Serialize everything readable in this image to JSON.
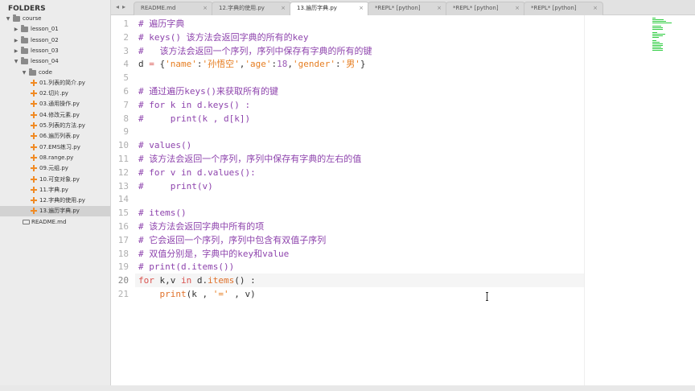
{
  "sidebar": {
    "header": "FOLDERS",
    "items": [
      {
        "label": "course",
        "type": "folder",
        "expanded": true,
        "depth": 0
      },
      {
        "label": "lesson_01",
        "type": "folder",
        "expanded": false,
        "depth": 1
      },
      {
        "label": "lesson_02",
        "type": "folder",
        "expanded": false,
        "depth": 1
      },
      {
        "label": "lesson_03",
        "type": "folder",
        "expanded": false,
        "depth": 1
      },
      {
        "label": "lesson_04",
        "type": "folder",
        "expanded": true,
        "depth": 1
      },
      {
        "label": "code",
        "type": "folder",
        "expanded": true,
        "depth": 2
      },
      {
        "label": "01.列表的简介.py",
        "type": "py",
        "depth": 3
      },
      {
        "label": "02.切片.py",
        "type": "py",
        "depth": 3
      },
      {
        "label": "03.通用操作.py",
        "type": "py",
        "depth": 3
      },
      {
        "label": "04.修改元素.py",
        "type": "py",
        "depth": 3
      },
      {
        "label": "05.列表的方法.py",
        "type": "py",
        "depth": 3
      },
      {
        "label": "06.遍历列表.py",
        "type": "py",
        "depth": 3
      },
      {
        "label": "07.EMS练习.py",
        "type": "py",
        "depth": 3
      },
      {
        "label": "08.range.py",
        "type": "py",
        "depth": 3
      },
      {
        "label": "09.元组.py",
        "type": "py",
        "depth": 3
      },
      {
        "label": "10.可变对象.py",
        "type": "py",
        "depth": 3
      },
      {
        "label": "11.字典.py",
        "type": "py",
        "depth": 3
      },
      {
        "label": "12.字典的使用.py",
        "type": "py",
        "depth": 3
      },
      {
        "label": "13.遍历字典.py",
        "type": "py",
        "depth": 3,
        "selected": true
      },
      {
        "label": "README.md",
        "type": "md",
        "depth": 2
      }
    ]
  },
  "tabs": {
    "back_arrow": "◂",
    "forward_arrow": "▸",
    "items": [
      {
        "label": "README.md",
        "active": false
      },
      {
        "label": "12.字典的使用.py",
        "active": false
      },
      {
        "label": "13.遍历字典.py",
        "active": true
      },
      {
        "label": "*REPL* [python]",
        "active": false
      },
      {
        "label": "*REPL* [python]",
        "active": false
      },
      {
        "label": "*REPL* [python]",
        "active": false
      }
    ],
    "close_glyph": "×"
  },
  "editor": {
    "current_line": 20,
    "lines": [
      [
        {
          "t": "c",
          "v": "# 遍历字典"
        }
      ],
      [
        {
          "t": "c",
          "v": "# keys() 该方法会返回字典的所有的key"
        }
      ],
      [
        {
          "t": "c",
          "v": "#   该方法会返回一个序列，序列中保存有字典的所有的键"
        }
      ],
      [
        {
          "t": "plain",
          "v": "d "
        },
        {
          "t": "op",
          "v": "="
        },
        {
          "t": "plain",
          "v": " {"
        },
        {
          "t": "str",
          "v": "'name'"
        },
        {
          "t": "plain",
          "v": ":"
        },
        {
          "t": "str",
          "v": "'孙悟空'"
        },
        {
          "t": "plain",
          "v": ","
        },
        {
          "t": "str",
          "v": "'age'"
        },
        {
          "t": "plain",
          "v": ":"
        },
        {
          "t": "num",
          "v": "18"
        },
        {
          "t": "plain",
          "v": ","
        },
        {
          "t": "str",
          "v": "'gender'"
        },
        {
          "t": "plain",
          "v": ":"
        },
        {
          "t": "str",
          "v": "'男'"
        },
        {
          "t": "plain",
          "v": "}"
        }
      ],
      [],
      [
        {
          "t": "c",
          "v": "# 通过遍历keys()来获取所有的键"
        }
      ],
      [
        {
          "t": "c",
          "v": "# for k in d.keys() :"
        }
      ],
      [
        {
          "t": "c",
          "v": "#     print(k , d[k])"
        }
      ],
      [],
      [
        {
          "t": "c",
          "v": "# values()"
        }
      ],
      [
        {
          "t": "c",
          "v": "# 该方法会返回一个序列，序列中保存有字典的左右的值"
        }
      ],
      [
        {
          "t": "c",
          "v": "# for v in d.values():"
        }
      ],
      [
        {
          "t": "c",
          "v": "#     print(v)"
        }
      ],
      [],
      [
        {
          "t": "c",
          "v": "# items()"
        }
      ],
      [
        {
          "t": "c",
          "v": "# 该方法会返回字典中所有的项"
        }
      ],
      [
        {
          "t": "c",
          "v": "# 它会返回一个序列，序列中包含有双值子序列"
        }
      ],
      [
        {
          "t": "c",
          "v": "# 双值分别是，字典中的key和value"
        }
      ],
      [
        {
          "t": "c",
          "v": "# print(d.items())"
        }
      ],
      [
        {
          "t": "kw",
          "v": "for"
        },
        {
          "t": "plain",
          "v": " k,v "
        },
        {
          "t": "kw",
          "v": "in"
        },
        {
          "t": "plain",
          "v": " d."
        },
        {
          "t": "fn",
          "v": "items"
        },
        {
          "t": "plain",
          "v": "() :"
        }
      ],
      [
        {
          "t": "plain",
          "v": "    "
        },
        {
          "t": "fn",
          "v": "print"
        },
        {
          "t": "plain",
          "v": "(k , "
        },
        {
          "t": "str",
          "v": "'='"
        },
        {
          "t": "plain",
          "v": " , v)"
        }
      ]
    ]
  },
  "colors": {
    "comment": "#8e44ad",
    "keyword": "#d9534f",
    "string": "#e67e22",
    "number": "#9b59b6",
    "minimap": "#2ecc40"
  },
  "icons": {
    "folder": "folder-icon",
    "py_file": "python-file-icon",
    "md_file": "markdown-file-icon",
    "expanded": "triangle-down-icon",
    "collapsed": "triangle-right-icon"
  }
}
